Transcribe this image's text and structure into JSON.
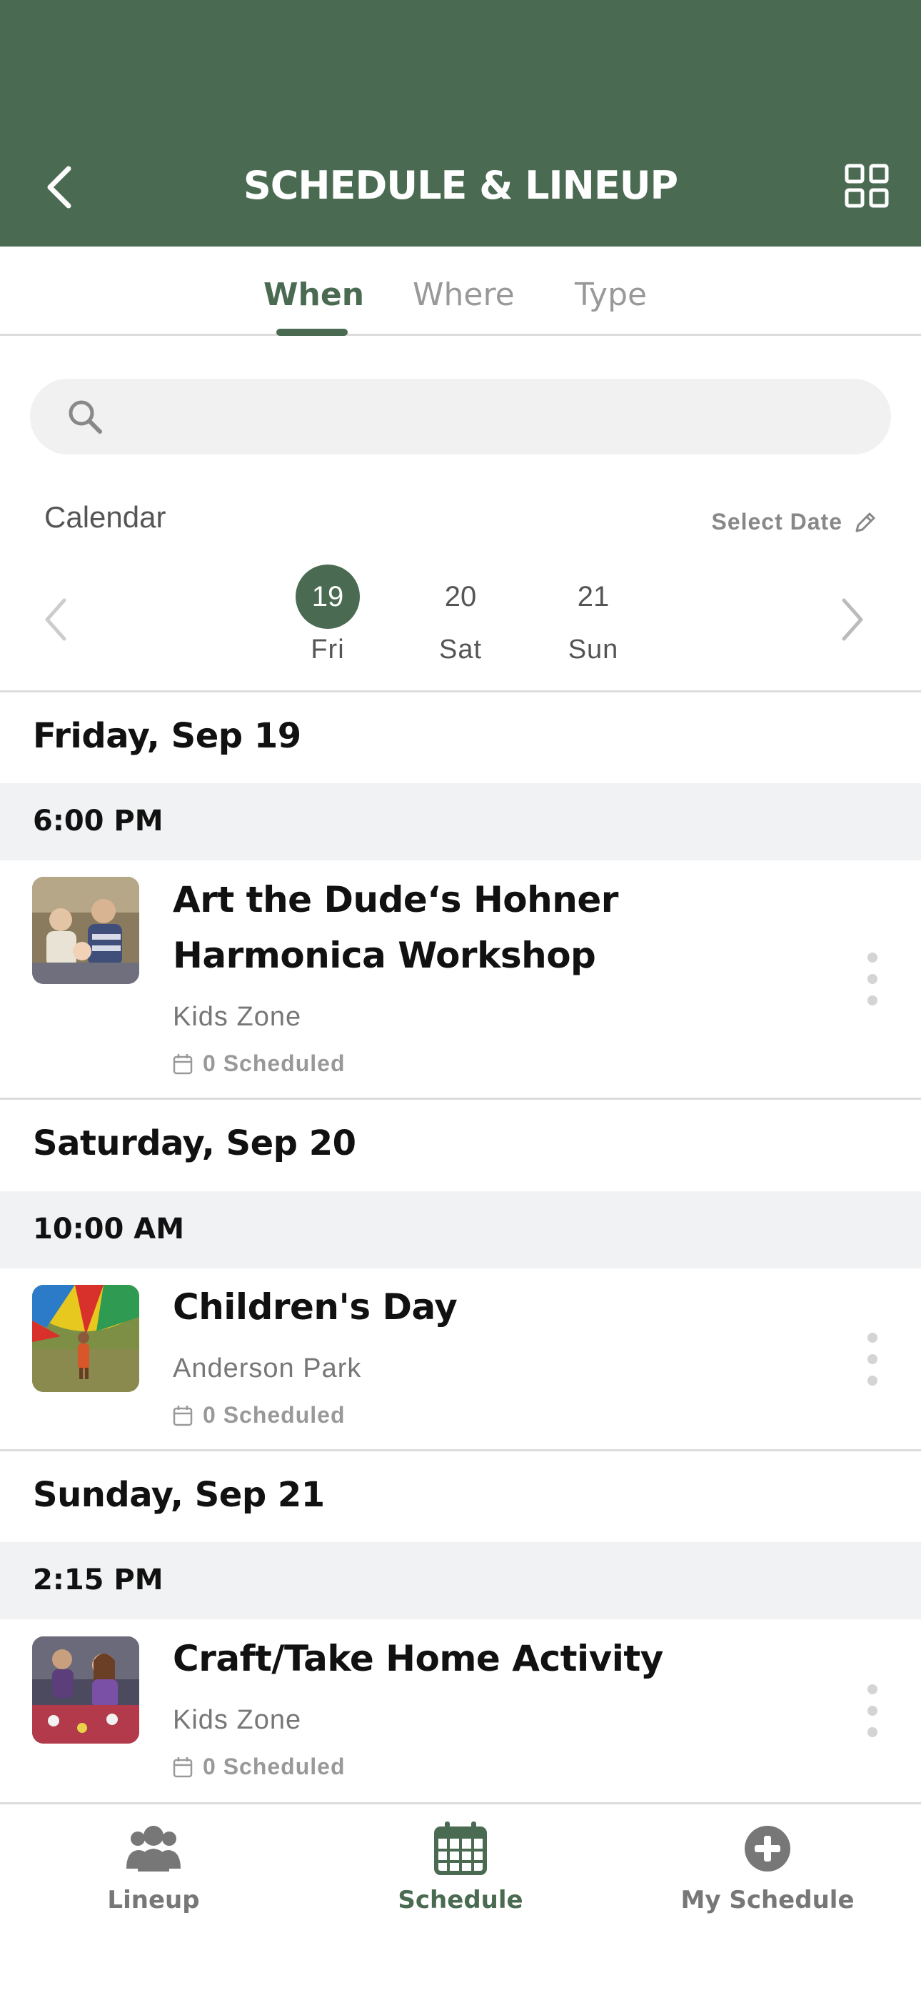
{
  "header": {
    "title": "SCHEDULE & LINEUP"
  },
  "tabs": [
    {
      "label": "When",
      "active": true
    },
    {
      "label": "Where",
      "active": false
    },
    {
      "label": "Type",
      "active": false
    }
  ],
  "search": {
    "placeholder": ""
  },
  "calendar": {
    "label": "Calendar",
    "select_date_label": "Select Date",
    "days": [
      {
        "num": "19",
        "name": "Fri",
        "selected": true
      },
      {
        "num": "20",
        "name": "Sat",
        "selected": false
      },
      {
        "num": "21",
        "name": "Sun",
        "selected": false
      }
    ]
  },
  "sections": [
    {
      "day": "Friday, Sep 19",
      "time": "6:00 PM",
      "event": {
        "title": "Art the Dude‘s Hohner Harmonica Workshop",
        "location": "Kids Zone",
        "scheduled": "0 Scheduled"
      }
    },
    {
      "day": "Saturday, Sep 20",
      "time": "10:00 AM",
      "event": {
        "title": "Children's Day",
        "location": "Anderson Park",
        "scheduled": "0 Scheduled"
      }
    },
    {
      "day": "Sunday, Sep 21",
      "time": "2:15 PM",
      "event": {
        "title": "Craft/Take Home Activity",
        "location": "Kids Zone",
        "scheduled": "0 Scheduled"
      }
    }
  ],
  "bottom_nav": [
    {
      "label": "Lineup",
      "icon": "people-icon",
      "active": false
    },
    {
      "label": "Schedule",
      "icon": "calendar-icon",
      "active": true
    },
    {
      "label": "My Schedule",
      "icon": "plus-circle-icon",
      "active": false
    }
  ],
  "colors": {
    "accent": "#4a6b52",
    "time_bar": "#f1f2f4",
    "muted": "#999999"
  }
}
